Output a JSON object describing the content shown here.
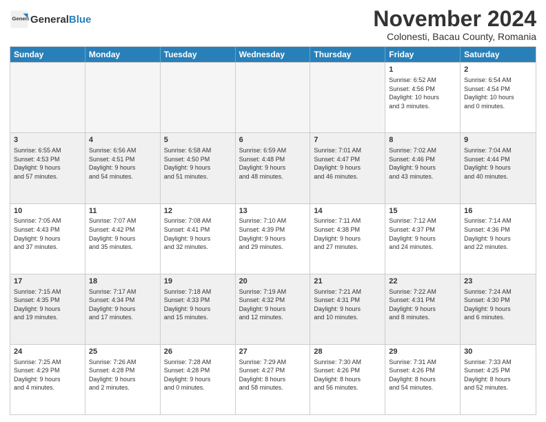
{
  "header": {
    "logo_general": "General",
    "logo_blue": "Blue",
    "month_title": "November 2024",
    "location": "Colonesti, Bacau County, Romania"
  },
  "days_of_week": [
    "Sunday",
    "Monday",
    "Tuesday",
    "Wednesday",
    "Thursday",
    "Friday",
    "Saturday"
  ],
  "rows": [
    [
      {
        "day": "",
        "info": "",
        "empty": true
      },
      {
        "day": "",
        "info": "",
        "empty": true
      },
      {
        "day": "",
        "info": "",
        "empty": true
      },
      {
        "day": "",
        "info": "",
        "empty": true
      },
      {
        "day": "",
        "info": "",
        "empty": true
      },
      {
        "day": "1",
        "info": "Sunrise: 6:52 AM\nSunset: 4:56 PM\nDaylight: 10 hours\nand 3 minutes.",
        "empty": false
      },
      {
        "day": "2",
        "info": "Sunrise: 6:54 AM\nSunset: 4:54 PM\nDaylight: 10 hours\nand 0 minutes.",
        "empty": false
      }
    ],
    [
      {
        "day": "3",
        "info": "Sunrise: 6:55 AM\nSunset: 4:53 PM\nDaylight: 9 hours\nand 57 minutes.",
        "empty": false
      },
      {
        "day": "4",
        "info": "Sunrise: 6:56 AM\nSunset: 4:51 PM\nDaylight: 9 hours\nand 54 minutes.",
        "empty": false
      },
      {
        "day": "5",
        "info": "Sunrise: 6:58 AM\nSunset: 4:50 PM\nDaylight: 9 hours\nand 51 minutes.",
        "empty": false
      },
      {
        "day": "6",
        "info": "Sunrise: 6:59 AM\nSunset: 4:48 PM\nDaylight: 9 hours\nand 48 minutes.",
        "empty": false
      },
      {
        "day": "7",
        "info": "Sunrise: 7:01 AM\nSunset: 4:47 PM\nDaylight: 9 hours\nand 46 minutes.",
        "empty": false
      },
      {
        "day": "8",
        "info": "Sunrise: 7:02 AM\nSunset: 4:46 PM\nDaylight: 9 hours\nand 43 minutes.",
        "empty": false
      },
      {
        "day": "9",
        "info": "Sunrise: 7:04 AM\nSunset: 4:44 PM\nDaylight: 9 hours\nand 40 minutes.",
        "empty": false
      }
    ],
    [
      {
        "day": "10",
        "info": "Sunrise: 7:05 AM\nSunset: 4:43 PM\nDaylight: 9 hours\nand 37 minutes.",
        "empty": false
      },
      {
        "day": "11",
        "info": "Sunrise: 7:07 AM\nSunset: 4:42 PM\nDaylight: 9 hours\nand 35 minutes.",
        "empty": false
      },
      {
        "day": "12",
        "info": "Sunrise: 7:08 AM\nSunset: 4:41 PM\nDaylight: 9 hours\nand 32 minutes.",
        "empty": false
      },
      {
        "day": "13",
        "info": "Sunrise: 7:10 AM\nSunset: 4:39 PM\nDaylight: 9 hours\nand 29 minutes.",
        "empty": false
      },
      {
        "day": "14",
        "info": "Sunrise: 7:11 AM\nSunset: 4:38 PM\nDaylight: 9 hours\nand 27 minutes.",
        "empty": false
      },
      {
        "day": "15",
        "info": "Sunrise: 7:12 AM\nSunset: 4:37 PM\nDaylight: 9 hours\nand 24 minutes.",
        "empty": false
      },
      {
        "day": "16",
        "info": "Sunrise: 7:14 AM\nSunset: 4:36 PM\nDaylight: 9 hours\nand 22 minutes.",
        "empty": false
      }
    ],
    [
      {
        "day": "17",
        "info": "Sunrise: 7:15 AM\nSunset: 4:35 PM\nDaylight: 9 hours\nand 19 minutes.",
        "empty": false
      },
      {
        "day": "18",
        "info": "Sunrise: 7:17 AM\nSunset: 4:34 PM\nDaylight: 9 hours\nand 17 minutes.",
        "empty": false
      },
      {
        "day": "19",
        "info": "Sunrise: 7:18 AM\nSunset: 4:33 PM\nDaylight: 9 hours\nand 15 minutes.",
        "empty": false
      },
      {
        "day": "20",
        "info": "Sunrise: 7:19 AM\nSunset: 4:32 PM\nDaylight: 9 hours\nand 12 minutes.",
        "empty": false
      },
      {
        "day": "21",
        "info": "Sunrise: 7:21 AM\nSunset: 4:31 PM\nDaylight: 9 hours\nand 10 minutes.",
        "empty": false
      },
      {
        "day": "22",
        "info": "Sunrise: 7:22 AM\nSunset: 4:31 PM\nDaylight: 9 hours\nand 8 minutes.",
        "empty": false
      },
      {
        "day": "23",
        "info": "Sunrise: 7:24 AM\nSunset: 4:30 PM\nDaylight: 9 hours\nand 6 minutes.",
        "empty": false
      }
    ],
    [
      {
        "day": "24",
        "info": "Sunrise: 7:25 AM\nSunset: 4:29 PM\nDaylight: 9 hours\nand 4 minutes.",
        "empty": false
      },
      {
        "day": "25",
        "info": "Sunrise: 7:26 AM\nSunset: 4:28 PM\nDaylight: 9 hours\nand 2 minutes.",
        "empty": false
      },
      {
        "day": "26",
        "info": "Sunrise: 7:28 AM\nSunset: 4:28 PM\nDaylight: 9 hours\nand 0 minutes.",
        "empty": false
      },
      {
        "day": "27",
        "info": "Sunrise: 7:29 AM\nSunset: 4:27 PM\nDaylight: 8 hours\nand 58 minutes.",
        "empty": false
      },
      {
        "day": "28",
        "info": "Sunrise: 7:30 AM\nSunset: 4:26 PM\nDaylight: 8 hours\nand 56 minutes.",
        "empty": false
      },
      {
        "day": "29",
        "info": "Sunrise: 7:31 AM\nSunset: 4:26 PM\nDaylight: 8 hours\nand 54 minutes.",
        "empty": false
      },
      {
        "day": "30",
        "info": "Sunrise: 7:33 AM\nSunset: 4:25 PM\nDaylight: 8 hours\nand 52 minutes.",
        "empty": false
      }
    ]
  ]
}
